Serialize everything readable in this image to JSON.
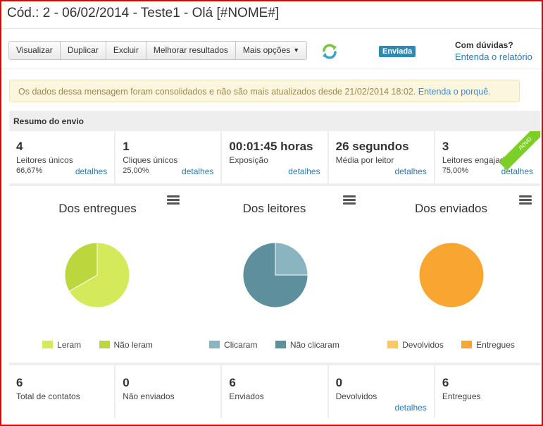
{
  "title": "Cód.: 2 - 06/02/2014 - Teste1 - Olá [#NOME#]",
  "toolbar": {
    "buttons": [
      "Visualizar",
      "Duplicar",
      "Excluir",
      "Melhorar resultados",
      "Mais opções"
    ],
    "refresh_icon": "refresh-icon"
  },
  "status_badge": "Enviada",
  "help": {
    "title": "Com dúvidas?",
    "link": "Entenda o relatório"
  },
  "alert": {
    "text": "Os dados dessa mensagem foram consolidados e não são mais atualizados desde 21/02/2014 18:02.",
    "link": "Entenda o porquê."
  },
  "summary": {
    "header": "Resumo do envio",
    "stats": [
      {
        "value": "4",
        "label": "Leitores únicos",
        "percent": "66,67%",
        "link": "detalhes"
      },
      {
        "value": "1",
        "label": "Cliques únicos",
        "percent": "25,00%",
        "link": "detalhes"
      },
      {
        "value": "00:01:45 horas",
        "label": "Exposição",
        "percent": "",
        "link": "detalhes"
      },
      {
        "value": "26 segundos",
        "label": "Média por leitor",
        "percent": "",
        "link": "detalhes"
      },
      {
        "value": "3",
        "label": "Leitores engajados",
        "percent": "75,00%",
        "link": "detalhes",
        "ribbon": "novo"
      }
    ]
  },
  "charts": [
    {
      "title": "Dos entregues",
      "slices": [
        {
          "label": "Leram",
          "value": 4,
          "color": "#d4ea5a"
        },
        {
          "label": "Não leram",
          "value": 2,
          "color": "#bcd63e"
        }
      ]
    },
    {
      "title": "Dos leitores",
      "slices": [
        {
          "label": "Clicaram",
          "value": 1,
          "color": "#8ab4c0"
        },
        {
          "label": "Não clicaram",
          "value": 3,
          "color": "#5e8f9c"
        }
      ]
    },
    {
      "title": "Dos enviados",
      "slices": [
        {
          "label": "Devolvidos",
          "value": 0,
          "color": "#fbc964"
        },
        {
          "label": "Entregues",
          "value": 6,
          "color": "#f9a531"
        }
      ]
    }
  ],
  "totals": [
    {
      "value": "6",
      "label": "Total de contatos",
      "link": ""
    },
    {
      "value": "0",
      "label": "Não enviados",
      "link": ""
    },
    {
      "value": "6",
      "label": "Enviados",
      "link": ""
    },
    {
      "value": "0",
      "label": "Devolvidos",
      "link": "detalhes"
    },
    {
      "value": "6",
      "label": "Entregues",
      "link": ""
    }
  ]
}
